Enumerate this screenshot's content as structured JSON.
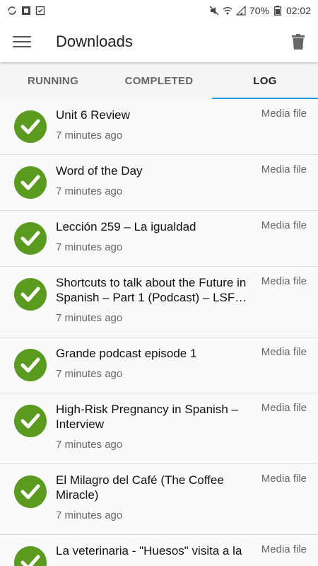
{
  "status_bar": {
    "battery": "70%",
    "time": "02:02"
  },
  "app_bar": {
    "title": "Downloads"
  },
  "tabs": [
    {
      "label": "RUNNING"
    },
    {
      "label": "COMPLETED"
    },
    {
      "label": "LOG"
    }
  ],
  "items": [
    {
      "title": "Unit 6 Review",
      "time": "7 minutes ago",
      "type": "Media file"
    },
    {
      "title": "Word of the Day",
      "time": "7 minutes ago",
      "type": "Media file"
    },
    {
      "title": "Lección 259 – La igualdad",
      "time": "7 minutes ago",
      "type": "Media file"
    },
    {
      "title": "Shortcuts to talk about the Future in Spanish – Part 1 (Podcast) – LSF…",
      "time": "7 minutes ago",
      "type": "Media file"
    },
    {
      "title": "Grande podcast episode 1",
      "time": "7 minutes ago",
      "type": "Media file"
    },
    {
      "title": "High-Risk Pregnancy in Spanish – Interview",
      "time": "7 minutes ago",
      "type": "Media file"
    },
    {
      "title": "El Milagro del Café (The Coffee Miracle)",
      "time": "7 minutes ago",
      "type": "Media file"
    },
    {
      "title": "La veterinaria - \"Huesos\" visita a la",
      "time": "",
      "type": "Media file"
    }
  ],
  "colors": {
    "accent": "#2196d3",
    "success": "#5a9a1f"
  }
}
